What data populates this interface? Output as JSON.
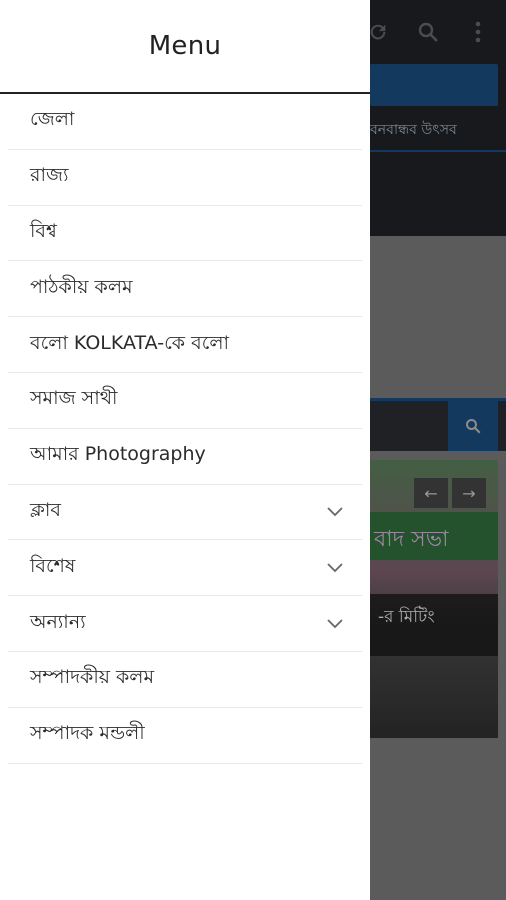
{
  "background": {
    "ticker_text": "বনবান্ধব উৎসব",
    "photo_overlay_text": "বাদ সভা",
    "caption_text": "-র মিটিং",
    "icons": [
      "refresh-icon",
      "search-icon",
      "more-vert-icon"
    ],
    "slider_prev": "←",
    "slider_next": "→",
    "colors": {
      "topbar": "#1f2226",
      "accent": "#1a4e7e"
    }
  },
  "drawer": {
    "title": "Menu",
    "items": [
      {
        "label": "জেলা",
        "expandable": false
      },
      {
        "label": "রাজ্য",
        "expandable": false
      },
      {
        "label": "বিশ্ব",
        "expandable": false
      },
      {
        "label": "পাঠকীয় কলম",
        "expandable": false
      },
      {
        "label": "বলো KOLKATA-কে বলো",
        "expandable": false
      },
      {
        "label": "সমাজ সাথী",
        "expandable": false
      },
      {
        "label": "আমার Photography",
        "expandable": false
      },
      {
        "label": "ক্লাব",
        "expandable": true
      },
      {
        "label": "বিশেষ",
        "expandable": true
      },
      {
        "label": "অন্যান্য",
        "expandable": true
      },
      {
        "label": "সম্পাদকীয় কলম",
        "expandable": false
      },
      {
        "label": "সম্পাদক মন্ডলী",
        "expandable": false
      }
    ]
  }
}
